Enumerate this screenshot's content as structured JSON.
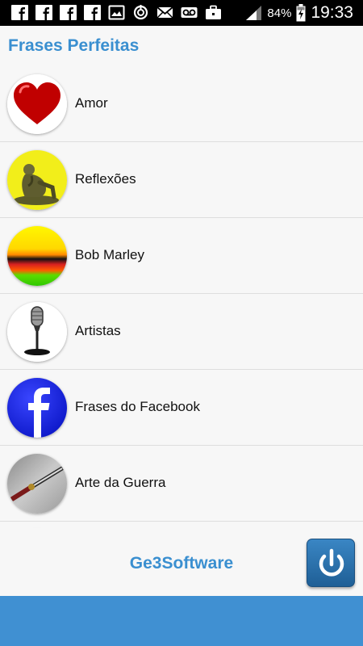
{
  "status_bar": {
    "battery_percent": "84%",
    "time": "19:33",
    "icons": [
      "facebook-icon",
      "facebook-icon",
      "facebook-icon",
      "facebook-icon",
      "image-icon",
      "sync-icon",
      "mail-icon",
      "voicemail-icon",
      "briefcase-icon",
      "signal-icon",
      "battery-charging-icon"
    ]
  },
  "app": {
    "title": "Frases Perfeitas"
  },
  "categories": [
    {
      "label": "Amor",
      "icon": "heart-icon"
    },
    {
      "label": "Reflexões",
      "icon": "thinker-statue-icon"
    },
    {
      "label": "Bob Marley",
      "icon": "rasta-flag-icon"
    },
    {
      "label": "Artistas",
      "icon": "microphone-icon"
    },
    {
      "label": "Frases do Facebook",
      "icon": "facebook-logo-icon"
    },
    {
      "label": "Arte da Guerra",
      "icon": "sword-icon"
    }
  ],
  "footer": {
    "brand": "Ge3Software",
    "power_button": "power-icon"
  },
  "colors": {
    "accent": "#3a8fd0",
    "bottom_bar": "#4090d2",
    "status_bar": "#000000"
  }
}
